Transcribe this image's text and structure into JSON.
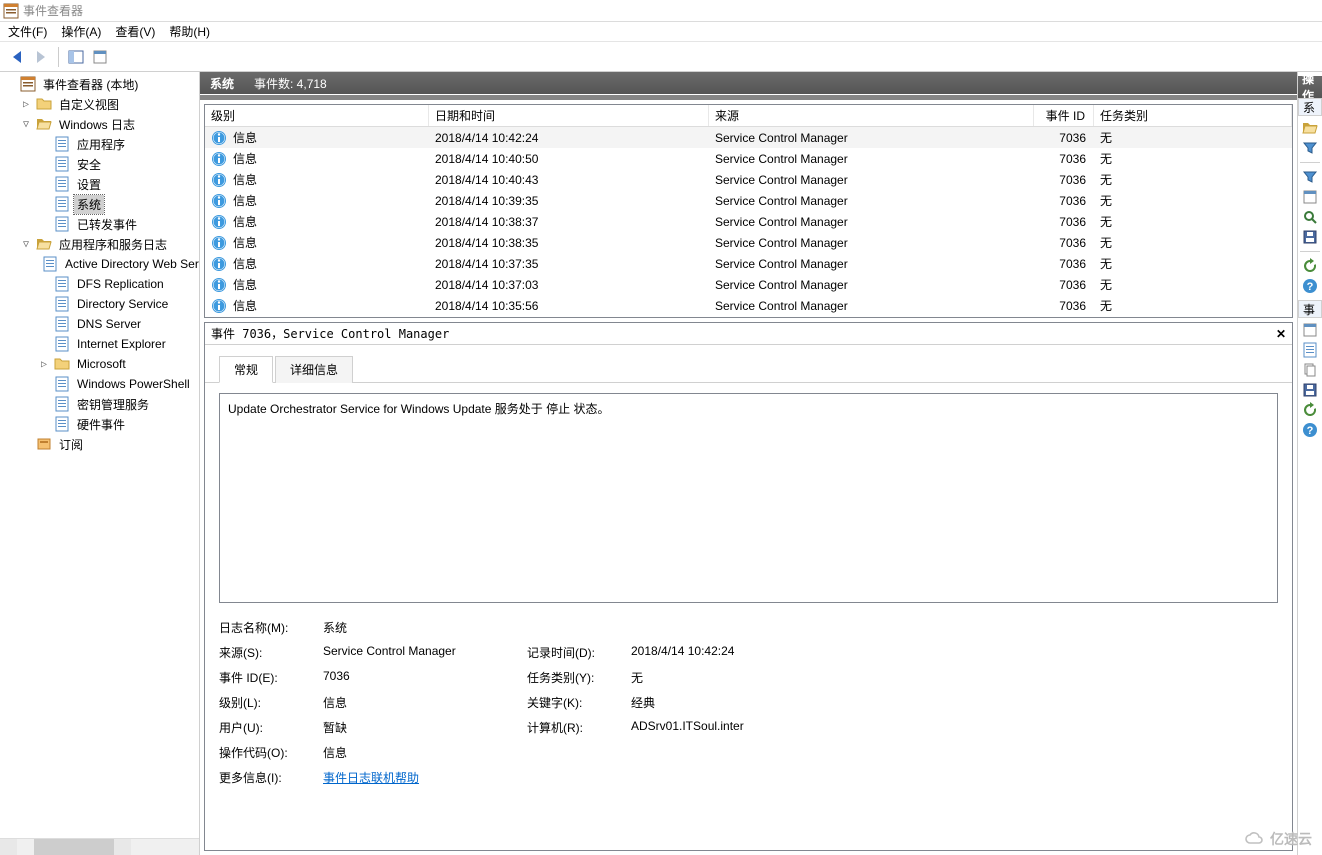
{
  "window": {
    "title": "事件查看器"
  },
  "menu": {
    "file": "文件(F)",
    "action": "操作(A)",
    "view": "查看(V)",
    "help": "帮助(H)"
  },
  "tree": {
    "root": "事件查看器 (本地)",
    "custom_views": "自定义视图",
    "windows_logs": "Windows 日志",
    "app": "应用程序",
    "security": "安全",
    "setup": "设置",
    "system": "系统",
    "forwarded": "已转发事件",
    "app_services": "应用程序和服务日志",
    "ad_ws": "Active Directory Web Services",
    "dfs": "DFS Replication",
    "ds": "Directory Service",
    "dns": "DNS Server",
    "ie": "Internet Explorer",
    "ms": "Microsoft",
    "ps": "Windows PowerShell",
    "keymgmt": "密钥管理服务",
    "hw": "硬件事件",
    "sub": "订阅"
  },
  "content": {
    "title": "系统",
    "count_label": "事件数: 4,718",
    "cols": {
      "level": "级别",
      "date": "日期和时间",
      "source": "来源",
      "id": "事件 ID",
      "task": "任务类别"
    },
    "rows": [
      {
        "level": "信息",
        "date": "2018/4/14 10:42:24",
        "source": "Service Control Manager",
        "id": "7036",
        "task": "无"
      },
      {
        "level": "信息",
        "date": "2018/4/14 10:40:50",
        "source": "Service Control Manager",
        "id": "7036",
        "task": "无"
      },
      {
        "level": "信息",
        "date": "2018/4/14 10:40:43",
        "source": "Service Control Manager",
        "id": "7036",
        "task": "无"
      },
      {
        "level": "信息",
        "date": "2018/4/14 10:39:35",
        "source": "Service Control Manager",
        "id": "7036",
        "task": "无"
      },
      {
        "level": "信息",
        "date": "2018/4/14 10:38:37",
        "source": "Service Control Manager",
        "id": "7036",
        "task": "无"
      },
      {
        "level": "信息",
        "date": "2018/4/14 10:38:35",
        "source": "Service Control Manager",
        "id": "7036",
        "task": "无"
      },
      {
        "level": "信息",
        "date": "2018/4/14 10:37:35",
        "source": "Service Control Manager",
        "id": "7036",
        "task": "无"
      },
      {
        "level": "信息",
        "date": "2018/4/14 10:37:03",
        "source": "Service Control Manager",
        "id": "7036",
        "task": "无"
      },
      {
        "level": "信息",
        "date": "2018/4/14 10:35:56",
        "source": "Service Control Manager",
        "id": "7036",
        "task": "无"
      }
    ]
  },
  "detail": {
    "title": "事件 7036，Service Control Manager",
    "tab_general": "常规",
    "tab_details": "详细信息",
    "description": "Update Orchestrator Service for Windows Update 服务处于 停止 状态。",
    "labels": {
      "log_name": "日志名称(M):",
      "source": "来源(S):",
      "event_id": "事件 ID(E):",
      "level": "级别(L):",
      "user": "用户(U):",
      "opcode": "操作代码(O):",
      "more": "更多信息(I):",
      "logged": "记录时间(D):",
      "task": "任务类别(Y):",
      "keywords": "关键字(K):",
      "computer": "计算机(R):"
    },
    "values": {
      "log_name": "系统",
      "source": "Service Control Manager",
      "event_id": "7036",
      "level": "信息",
      "user": "暂缺",
      "opcode": "信息",
      "more_link": "事件日志联机帮助",
      "logged": "2018/4/14 10:42:24",
      "task": "无",
      "keywords": "经典",
      "computer": "ADSrv01.ITSoul.inter"
    }
  },
  "actions": {
    "title": "操作",
    "group1": "系",
    "group2": "事"
  },
  "watermark": "亿速云"
}
